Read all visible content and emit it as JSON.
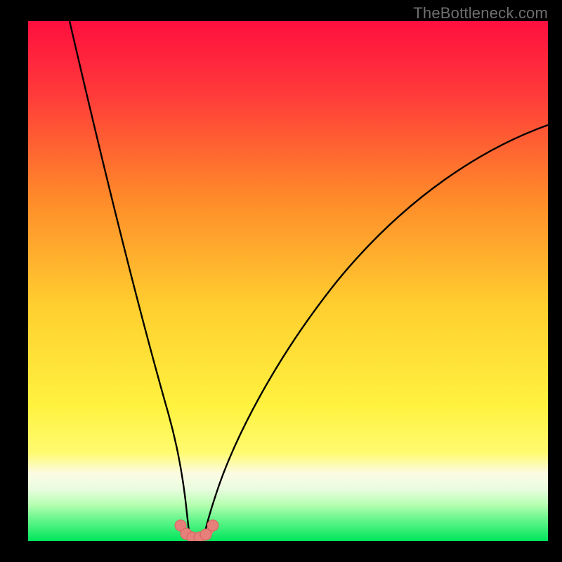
{
  "watermark": "TheBottleneck.com",
  "colors": {
    "frame": "#000000",
    "gradient_top": "#ff1040",
    "gradient_upper_mid": "#ff8a2a",
    "gradient_mid": "#ffe035",
    "gradient_lower_mid": "#fdfc5e",
    "gradient_band_pale": "#fbfbdc",
    "gradient_green_light": "#7fff6e",
    "gradient_green": "#00e65c",
    "curve_stroke": "#000000",
    "marker_fill": "#e77f7a",
    "marker_stroke": "#c9514e"
  },
  "chart_data": {
    "type": "line",
    "title": "",
    "xlabel": "",
    "ylabel": "",
    "xlim": [
      0,
      100
    ],
    "ylim": [
      0,
      100
    ],
    "series": [
      {
        "name": "left-branch",
        "x": [
          8,
          12,
          16,
          20,
          24,
          26,
          27.5,
          28.5,
          29.2,
          29.8
        ],
        "values": [
          100,
          78,
          58,
          40,
          23,
          13,
          7,
          3.5,
          1.5,
          0.7
        ]
      },
      {
        "name": "right-branch",
        "x": [
          33.2,
          34,
          36,
          39,
          44,
          52,
          62,
          74,
          88,
          100
        ],
        "values": [
          0.7,
          1.5,
          4,
          9,
          18,
          32,
          47,
          60,
          72,
          80
        ]
      },
      {
        "name": "optimum-markers",
        "x": [
          29.0,
          29.8,
          30.6,
          31.4,
          32.2,
          33.0,
          34.0
        ],
        "values": [
          2.0,
          0.9,
          0.5,
          0.5,
          0.6,
          1.0,
          2.2
        ]
      }
    ],
    "notes": "Axes have no tick labels in the source image; x and y are normalized 0–100. Curve depicts a bottleneck-style cost function with minimum near x≈31."
  }
}
